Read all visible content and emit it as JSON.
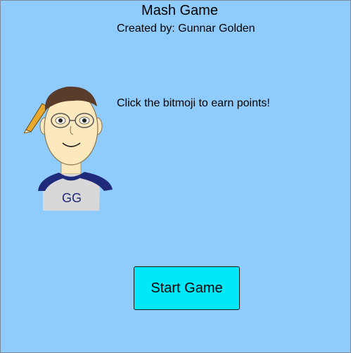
{
  "app": {
    "title": "Mash Game",
    "credit": "Created by: Gunnar Golden",
    "instruction": "Click the bitmoji to earn points!"
  },
  "bitmoji": {
    "shirt_text": "GG",
    "icon": "bitmoji-avatar-icon"
  },
  "start_button": {
    "label": "Start Game"
  },
  "colors": {
    "background": "#8fcbfb",
    "button": "#00e8fa",
    "shirt_sleeves": "#1f2a7a",
    "shirt_body": "#d8d8d8",
    "hair": "#5a3c2a",
    "skin": "#fbe8bc",
    "pencil": "#e8a92e"
  }
}
